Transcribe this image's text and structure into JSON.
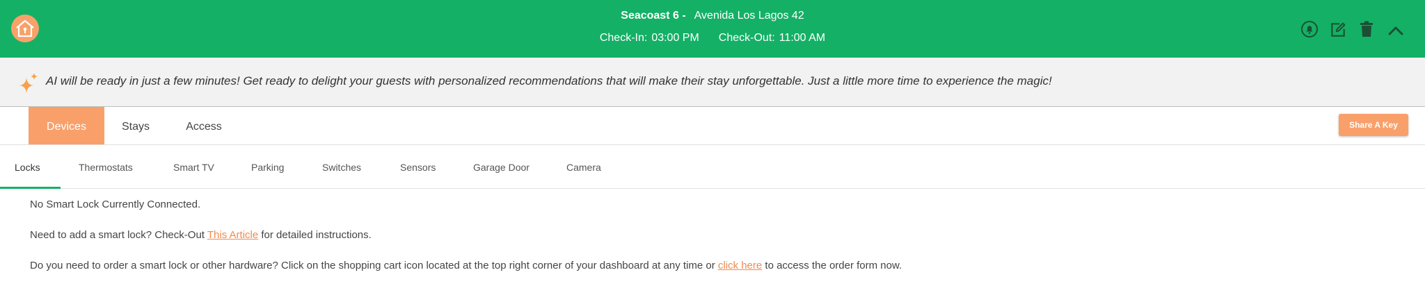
{
  "header": {
    "property_name": "Seacoast 6 -",
    "property_address": "Avenida Los Lagos 42",
    "checkin_label": "Check-In:",
    "checkin_time": "03:00 PM",
    "checkout_label": "Check-Out:",
    "checkout_time": "11:00 AM",
    "icons": [
      "logo-house-icon",
      "bell-icon",
      "edit-icon",
      "trash-icon",
      "chevron-up-icon"
    ]
  },
  "banner": {
    "text": "AI will be ready in just a few minutes! Get ready to delight your guests with personalized recommendations that will make their stay unforgettable. Just a little more time to experience the magic!",
    "icon": "sparkle-icon"
  },
  "main_tabs": [
    {
      "label": "Devices",
      "active": true
    },
    {
      "label": "Stays",
      "active": false
    },
    {
      "label": "Access",
      "active": false
    }
  ],
  "share_button": "Share A Key",
  "sub_tabs": [
    {
      "label": "Locks",
      "active": true
    },
    {
      "label": "Thermostats"
    },
    {
      "label": "Smart TV"
    },
    {
      "label": "Parking"
    },
    {
      "label": "Switches"
    },
    {
      "label": "Sensors"
    },
    {
      "label": "Garage Door"
    },
    {
      "label": "Camera"
    }
  ],
  "content": {
    "no_lock": "No Smart Lock Currently Connected.",
    "add_prefix": "Need to add a smart lock? Check-Out ",
    "add_link": "This Article",
    "add_suffix": " for detailed instructions.",
    "order_prefix": "Do you need to order a smart lock or other hardware? Click on the shopping cart icon located at the top right corner of your dashboard at any time or ",
    "order_link": "click here",
    "order_suffix": " to access the order form now."
  },
  "colors": {
    "header_green": "#14b066",
    "accent_orange": "#f9a06a",
    "link_orange": "#f28a4e",
    "banner_bg": "#f2f2f2"
  }
}
